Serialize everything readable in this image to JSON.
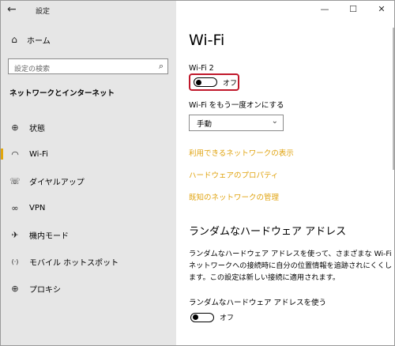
{
  "window": {
    "title": "設定"
  },
  "titlebar": {
    "back_icon": "←",
    "minimize": "—",
    "maximize": "☐",
    "close": "✕"
  },
  "sidebar": {
    "home_label": "ホーム",
    "search_placeholder": "設定の検索",
    "section_title": "ネットワークとインターネット",
    "items": [
      {
        "label": "状態",
        "icon": "globe-icon",
        "glyph": "⊕"
      },
      {
        "label": "Wi-Fi",
        "icon": "wifi-icon",
        "glyph": "◠"
      },
      {
        "label": "ダイヤルアップ",
        "icon": "phone-icon",
        "glyph": "☏"
      },
      {
        "label": "VPN",
        "icon": "vpn-icon",
        "glyph": "∞"
      },
      {
        "label": "機内モード",
        "icon": "airplane-icon",
        "glyph": "✈"
      },
      {
        "label": "モバイル ホットスポット",
        "icon": "hotspot-icon",
        "glyph": "(·)"
      },
      {
        "label": "プロキシ",
        "icon": "globe-icon",
        "glyph": "⊕"
      }
    ],
    "active_index": 1
  },
  "main": {
    "title": "Wi-Fi",
    "adapter_label": "Wi-Fi 2",
    "toggle_state": "オフ",
    "turn_back_label": "Wi-Fi をもう一度オンにする",
    "dropdown_value": "手動",
    "links": [
      "利用できるネットワークの表示",
      "ハードウェアのプロパティ",
      "既知のネットワークの管理"
    ],
    "section2_title": "ランダムなハードウェア アドレス",
    "section2_text": "ランダムなハードウェア アドレスを使って、さまざまな Wi-Fi ネットワークへの接続時に自分の位置情報を追跡されにくくします。この設定は新しい接続に適用されます。",
    "random_label": "ランダムなハードウェア アドレスを使う",
    "random_toggle_state": "オフ"
  },
  "colors": {
    "accent": "#e0a30f",
    "highlight_border": "#c0182b",
    "sidebar_bg": "#e6e6e6"
  }
}
